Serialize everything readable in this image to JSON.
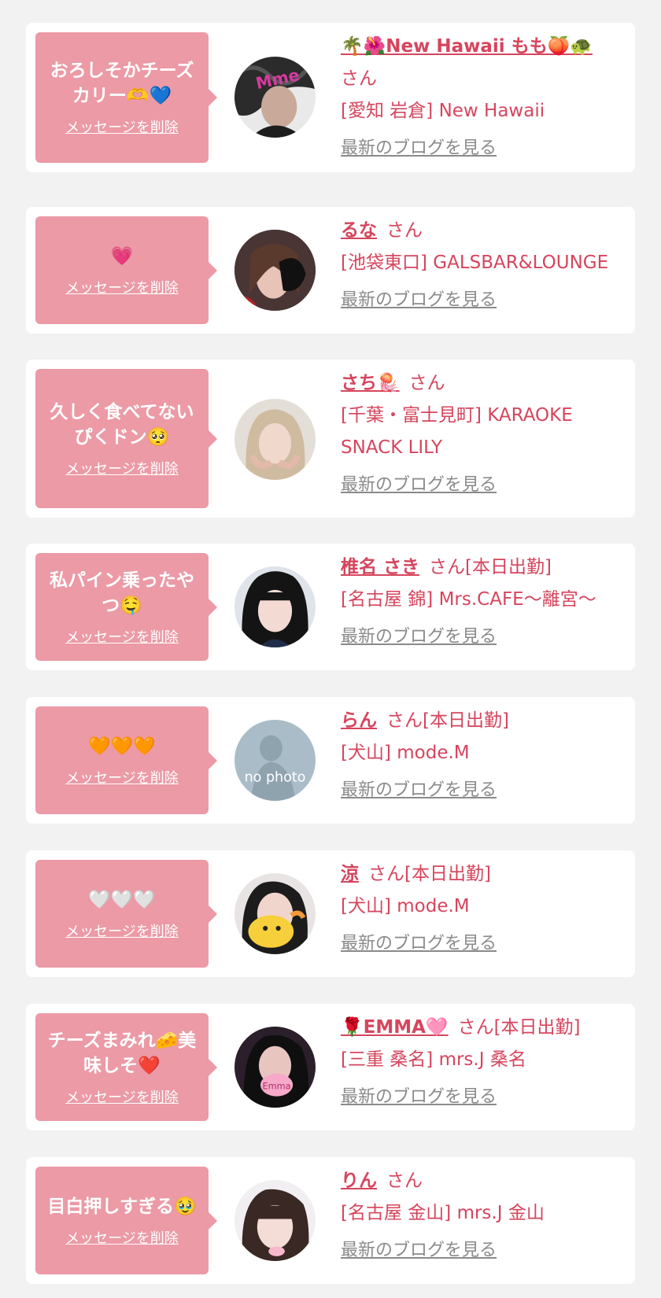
{
  "common": {
    "delete_label": "メッセージを削除",
    "san_label": "さん",
    "blog_label": "最新のブログを見る"
  },
  "colors": {
    "background": "#f2f2f2",
    "bubble": "#eb9aa6",
    "accent": "#d6455d",
    "link_gray": "#8a8a8a"
  },
  "messages": [
    {
      "message": "おろしそかチーズカリー🫶💙",
      "name": "🌴🌺New Hawaii もも🍑🐢",
      "status": "",
      "shop": "[愛知 岩倉] New Hawaii"
    },
    {
      "message": "💗",
      "name": "るな",
      "status": "",
      "shop": "[池袋東口] GALSBAR&LOUNGE"
    },
    {
      "message": "久しく食べてないぴくドン🥺",
      "name": "さち🪼",
      "status": "",
      "shop": "[千葉・富士見町] KARAOKE SNACK LILY"
    },
    {
      "message": "私パイン乗ったやつ🤤",
      "name": "椎名 さき",
      "status": "[本日出勤]",
      "shop": "[名古屋 錦] Mrs.CAFE〜離宮〜"
    },
    {
      "message": "🧡🧡🧡",
      "name": "らん",
      "status": "[本日出勤]",
      "shop": "[犬山] mode.M",
      "avatar_text": "no photo"
    },
    {
      "message": "🤍🤍🤍",
      "name": "涼",
      "status": "[本日出勤]",
      "shop": "[犬山] mode.M"
    },
    {
      "message": "チーズまみれ🧀美味しそ❤️",
      "name": "🌹EMMA🩷",
      "status": "[本日出勤]",
      "shop": "[三重 桑名] mrs.J 桑名",
      "avatar_text": "Emma"
    },
    {
      "message": "目白押しすぎる🥹",
      "name": "りん",
      "status": "",
      "shop": "[名古屋 金山] mrs.J 金山"
    }
  ]
}
